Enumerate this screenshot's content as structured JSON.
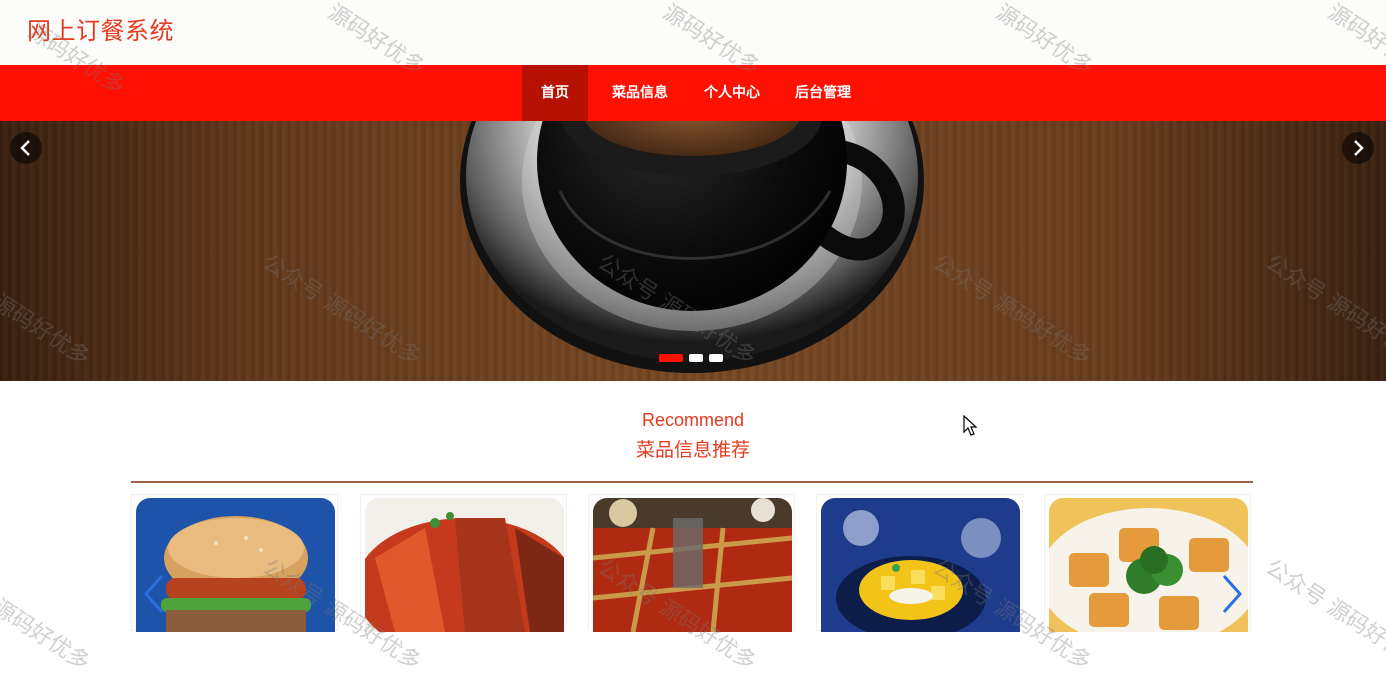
{
  "header": {
    "logo_text": "网上订餐系统"
  },
  "nav": {
    "items": [
      {
        "label": "首页",
        "active": true
      },
      {
        "label": "菜品信息",
        "active": false
      },
      {
        "label": "个人中心",
        "active": false
      },
      {
        "label": "后台管理",
        "active": false
      }
    ]
  },
  "banner": {
    "slide_count": 3,
    "active_slide": 1,
    "prev_icon": "chevron-left-icon",
    "next_icon": "chevron-right-icon"
  },
  "recommend": {
    "title_en": "Recommend",
    "title_cn": "菜品信息推荐",
    "cards": [
      {
        "image": "burger"
      },
      {
        "image": "sliced-meat"
      },
      {
        "image": "hotpot"
      },
      {
        "image": "mango-dessert"
      },
      {
        "image": "stuffed-tofu"
      }
    ]
  },
  "watermark": {
    "text_a": "公众号 源码好优多",
    "text_b": "源码好优多"
  },
  "colors": {
    "brand_red": "#fe1003",
    "active_nav": "#b71103",
    "title_red": "#e63a1f"
  }
}
